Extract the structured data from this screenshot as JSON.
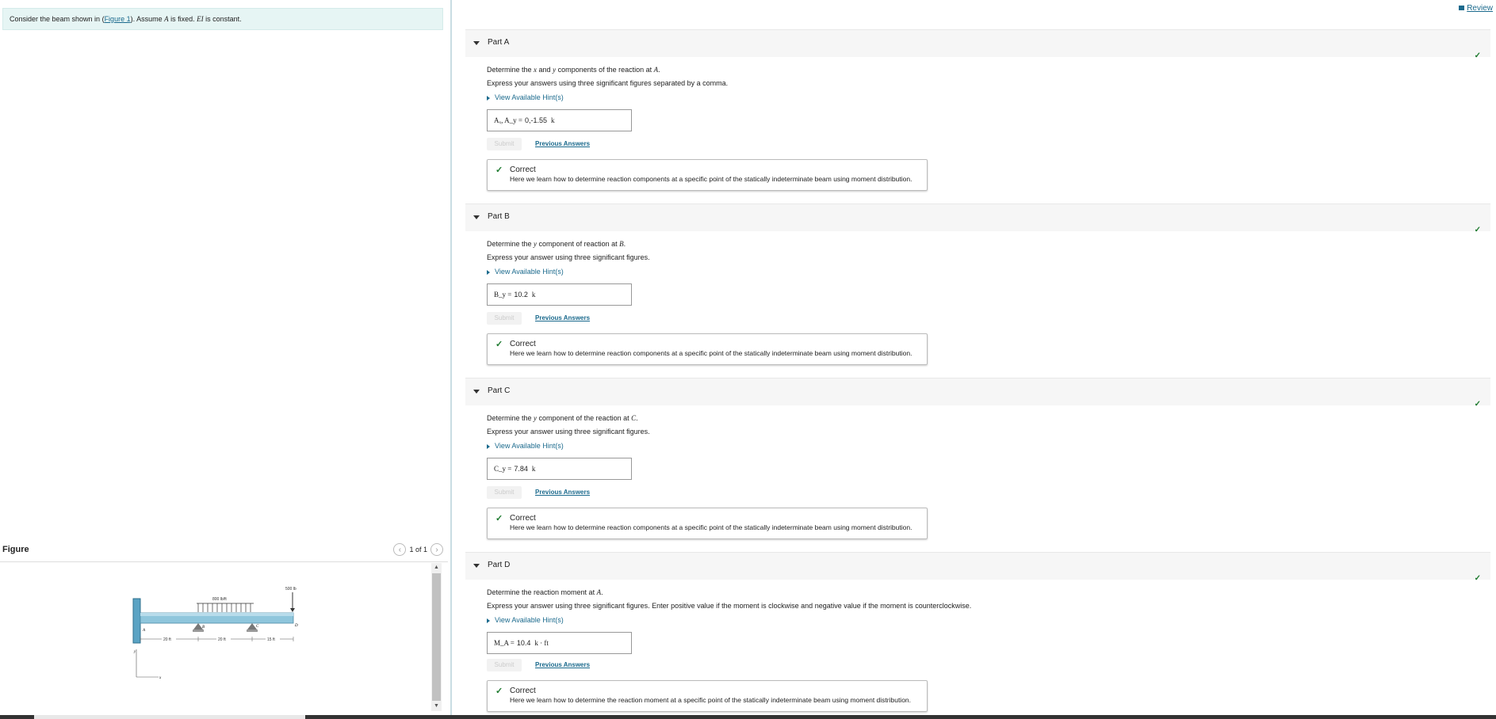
{
  "problem": {
    "prefix": "Consider the beam shown in (",
    "figure_link": "Figure 1",
    "mid": "). Assume ",
    "var_A": "A",
    "mid2": " is fixed. ",
    "var_EI": "EI",
    "suffix": " is constant."
  },
  "review": "Review",
  "figure": {
    "title": "Figure",
    "pager": "1 of 1",
    "load_label": "800 lb/ft",
    "point_label": "500 lb",
    "span1": "20 ft",
    "span2": "20 ft",
    "span3": "15 ft",
    "pt_A": "A",
    "pt_B": "B",
    "pt_C": "C",
    "pt_D": "D",
    "axis_y": "y",
    "axis_x": "x"
  },
  "common": {
    "hint": "View Available Hint(s)",
    "submit": "Submit",
    "previous": "Previous Answers",
    "correct": "Correct",
    "check": "✓"
  },
  "parts": [
    {
      "title": "Part A",
      "q_pre": "Determine the ",
      "q_v1": "x",
      "q_mid": " and ",
      "q_v2": "y",
      "q_post": " components of the reaction at ",
      "q_v3": "A",
      "q_end": ".",
      "express": "Express your answers using three significant figures separated by a comma.",
      "ans_label": "Aₓ, A_y =",
      "ans_value": "0,-1.55",
      "ans_unit": "k",
      "feedback": "Here we learn how to determine reaction components at a specific point of the statically indeterminate beam using moment distribution."
    },
    {
      "title": "Part B",
      "q_pre": "Determine the ",
      "q_v1": "y",
      "q_mid": " component of reaction at ",
      "q_v2": "B",
      "q_post": ".",
      "express": "Express your answer using three significant figures.",
      "ans_label": "B_y =",
      "ans_value": "10.2",
      "ans_unit": "k",
      "feedback": "Here we learn how to determine reaction components at a specific point of the statically indeterminate beam using moment distribution."
    },
    {
      "title": "Part C",
      "q_pre": "Determine the ",
      "q_v1": "y",
      "q_mid": " component of the reaction at ",
      "q_v2": "C",
      "q_post": ".",
      "express": "Express your answer using three significant figures.",
      "ans_label": "C_y =",
      "ans_value": "7.84",
      "ans_unit": "k",
      "feedback": "Here we learn how to determine reaction components at a specific point of the statically indeterminate beam using moment distribution."
    },
    {
      "title": "Part D",
      "q_pre": "Determine the reaction moment at ",
      "q_v1": "A",
      "q_post": ".",
      "express": "Express your answer using three significant figures. Enter positive value if the moment is clockwise and negative value if the moment is counterclockwise.",
      "ans_label": "M_A =",
      "ans_value": "10.4",
      "ans_unit": "k · ft",
      "feedback": "Here we learn how to determine the reaction moment at a specific point of the statically indeterminate beam using moment distribution."
    }
  ]
}
